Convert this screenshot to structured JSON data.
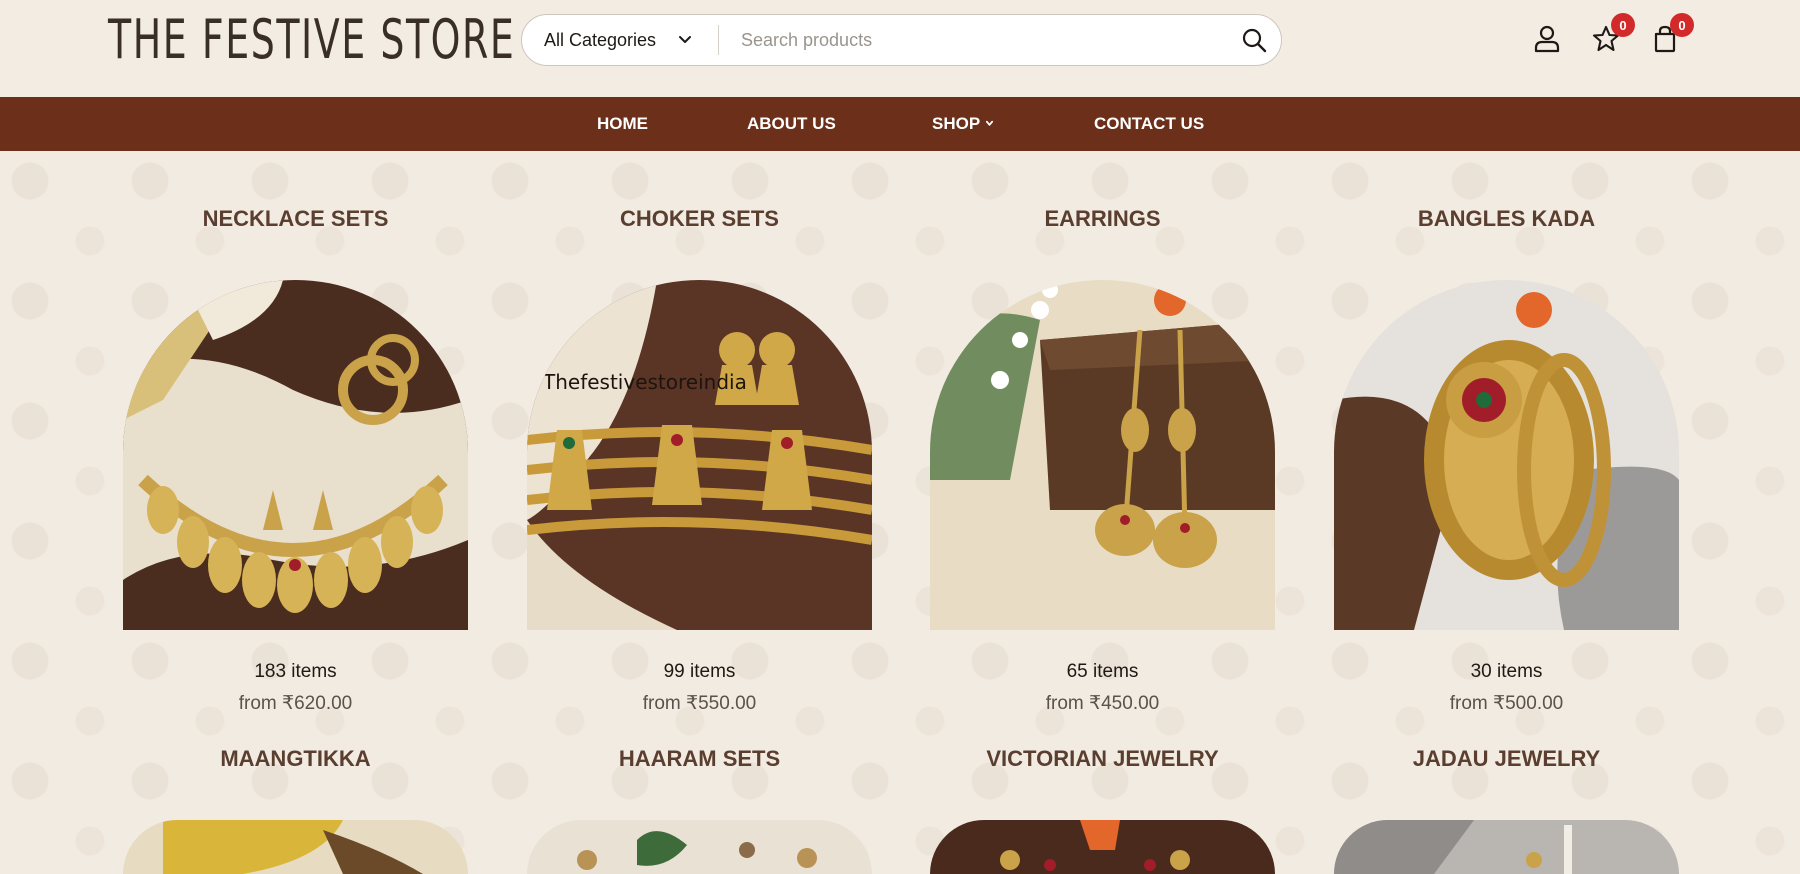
{
  "header": {
    "logo": "THE FESTIVE STORE",
    "category_select": "All Categories",
    "search_placeholder": "Search products",
    "wishlist_count": "0",
    "cart_count": "0"
  },
  "nav": {
    "items": [
      "HOME",
      "ABOUT US",
      "SHOP",
      "CONTACT US"
    ]
  },
  "categories": [
    {
      "title": "NECKLACE SETS",
      "count": "183 items",
      "price": "from ₹620.00",
      "watermark": ""
    },
    {
      "title": "CHOKER SETS",
      "count": "99 items",
      "price": "from ₹550.00",
      "watermark": "Thefestivestoreindia"
    },
    {
      "title": "EARRINGS",
      "count": "65 items",
      "price": "from ₹450.00",
      "watermark": ""
    },
    {
      "title": "BANGLES KADA",
      "count": "30 items",
      "price": "from ₹500.00",
      "watermark": ""
    },
    {
      "title": "MAANGTIKKA"
    },
    {
      "title": "HAARAM SETS"
    },
    {
      "title": "VICTORIAN JEWELRY"
    },
    {
      "title": "JADAU JEWELRY"
    }
  ],
  "colors": {
    "background": "#f3ece2",
    "nav_bar": "#6b2f1a",
    "badge": "#d22a2a",
    "category_title": "#5a3e30"
  }
}
